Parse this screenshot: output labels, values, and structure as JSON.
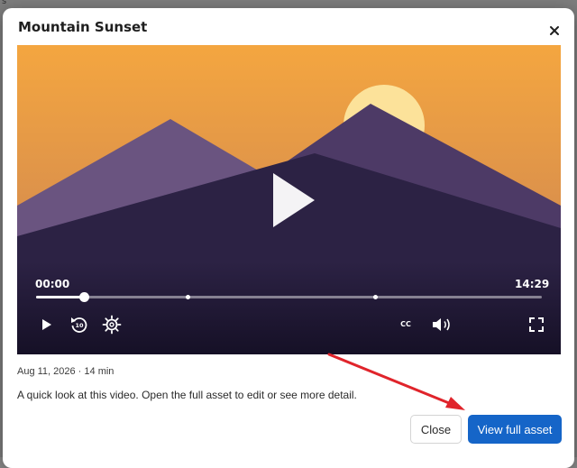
{
  "background": {
    "corner_glyph": "s"
  },
  "modal": {
    "title": "Mountain Sunset",
    "close_icon": "close-icon",
    "meta": "Aug 11, 2026 · 14 min",
    "description": "A quick look at this video. Open the full asset to edit or see more detail.",
    "buttons": {
      "close_label": "Close",
      "view_label": "View full asset"
    }
  },
  "video": {
    "current_time": "00:00",
    "total_time": "14:29",
    "progress_fraction": 0.095,
    "chapter_markers": [
      0.3,
      0.67
    ],
    "controls": {
      "play_icon": "play-icon",
      "replay_icon": "replay-10-icon",
      "replay_label": "10",
      "settings_icon": "settings-gear-icon",
      "captions_label": "CC",
      "volume_icon": "volume-icon",
      "fullscreen_icon": "fullscreen-icon"
    },
    "colors": {
      "sky_top": "#f4a640",
      "sky_bottom": "#c57e55",
      "sun": "#fce29a",
      "mountain_light": "#6a5480",
      "mountain_mid": "#4d3a66",
      "mountain_dark": "#2c2244",
      "accent_button": "#1565c8"
    }
  },
  "annotation": {
    "arrow_color": "#e0242b"
  }
}
